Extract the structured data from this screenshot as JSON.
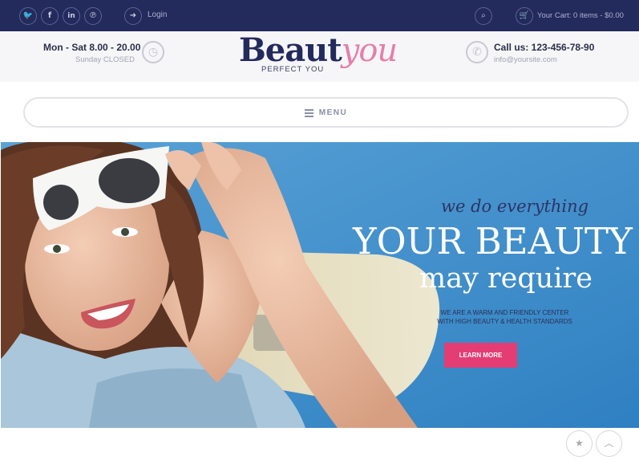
{
  "topbar": {
    "social": [
      {
        "icon": "twitter-icon",
        "glyph": "🐦"
      },
      {
        "icon": "facebook-icon",
        "glyph": "f"
      },
      {
        "icon": "linkedin-icon",
        "glyph": "in"
      },
      {
        "icon": "pinterest-icon",
        "glyph": "p"
      }
    ],
    "login_label": "Login",
    "cart_label": "Your Cart: 0 items - $0.00"
  },
  "header": {
    "hours_main": "Mon - Sat 8.00 - 20.00",
    "hours_sub": "Sunday CLOSED",
    "logo_part1": "Beaut",
    "logo_part2": "you",
    "tagline": "PERFECT YOU",
    "call_main": "Call us: 123-456-78-90",
    "call_sub": "info@yoursite.com"
  },
  "menu": {
    "label": "MENU"
  },
  "hero": {
    "script": "we do everything",
    "title": "YOUR BEAUTY",
    "subtitle": "may require",
    "small_line1": "WE ARE A WARM AND FRIENDLY CENTER",
    "small_line2": "WITH HIGH BEAUTY & HEALTH STANDARDS",
    "button_label": "LEARN MORE"
  },
  "colors": {
    "topbar_bg": "#232a5c",
    "brand_navy": "#232a5c",
    "brand_pink": "#e57faa",
    "button_pink": "#e33d74",
    "hero_blue": "#3d8fcb"
  }
}
